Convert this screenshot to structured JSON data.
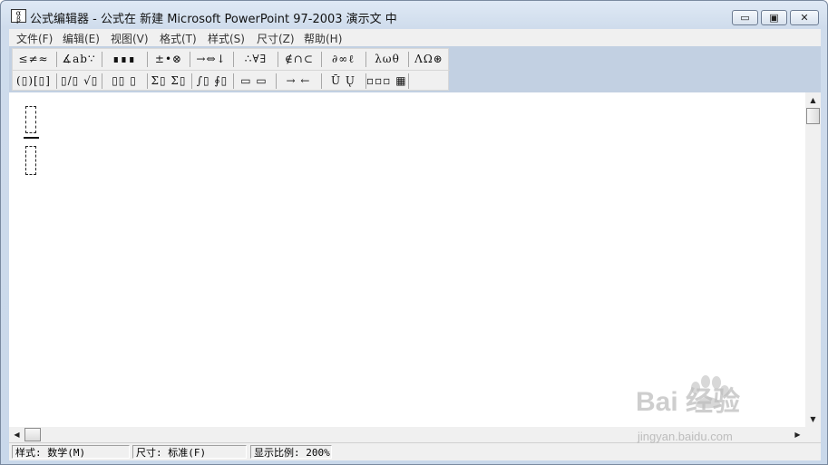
{
  "window": {
    "title": "公式编辑器 - 公式在 新建 Microsoft PowerPoint 97-2003 演示文 中",
    "controls": {
      "minimize": "▭",
      "maximize": "▣",
      "close": "✕"
    }
  },
  "menu": {
    "items": [
      "文件(F)",
      "编辑(E)",
      "视图(V)",
      "格式(T)",
      "样式(S)",
      "尺寸(Z)",
      "帮助(H)"
    ]
  },
  "palette": {
    "row1": [
      "≤≠≈",
      "∡ab∵",
      "∎∎∎",
      "±•⊗",
      "→⇔↓",
      "∴∀∃",
      "∉∩⊂",
      "∂∞ℓ",
      "λωθ",
      "ΛΩ⊛"
    ],
    "row2": [
      "(▯)[▯]",
      "▯/▯ √▯",
      "▯▯ ▯",
      "Σ▯ Σ▯",
      "∫▯ ∮▯",
      "▭ ▭",
      "→ ←",
      "Ū Ų",
      "▫▫▫ ▦"
    ]
  },
  "status": {
    "style": "样式: 数学(M)",
    "size": "尺寸: 标准(F)",
    "zoom": "显示比例: 200%"
  },
  "watermark": {
    "brand": "Bai  经验",
    "url": "jingyan.baidu.com"
  },
  "icons": {
    "app": "equation-editor-icon",
    "scroll_up": "▲",
    "scroll_down": "▼",
    "scroll_left": "◀",
    "scroll_right": "▶"
  }
}
